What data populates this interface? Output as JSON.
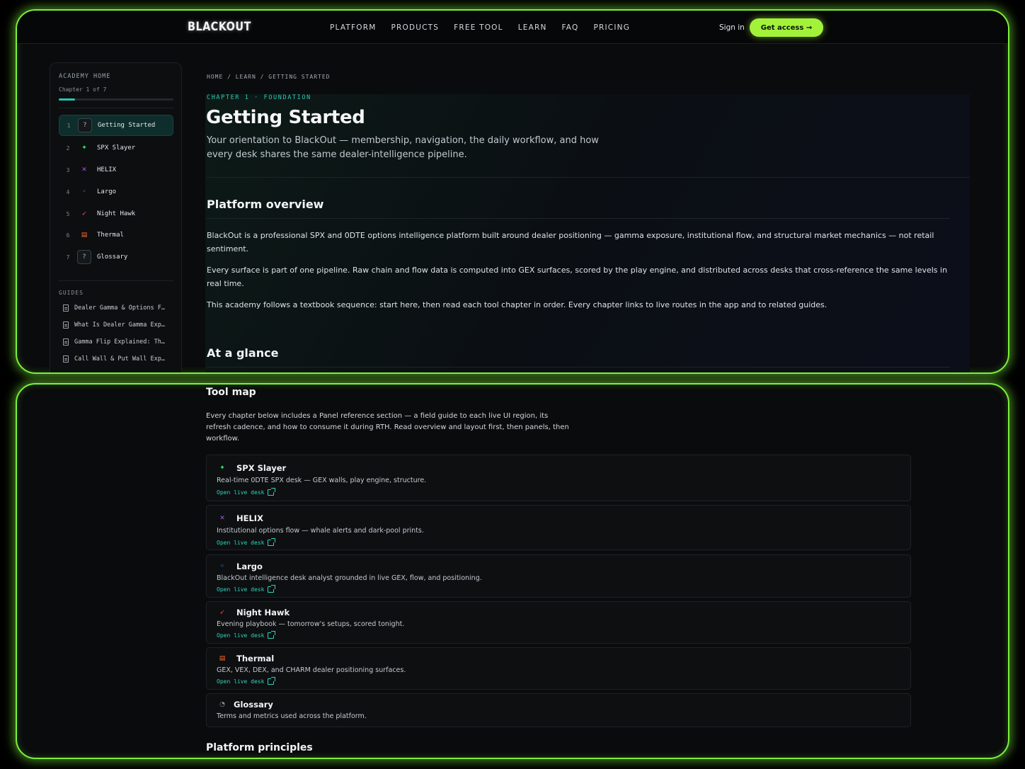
{
  "header": {
    "logo": "BLACKOUT",
    "nav": [
      "PLATFORM",
      "PRODUCTS",
      "FREE TOOL",
      "LEARN",
      "FAQ",
      "PRICING"
    ],
    "sign_in": "Sign in",
    "cta": "Get access →"
  },
  "sidebar": {
    "heading": "ACADEMY HOME",
    "progress_label": "Chapter 1 of 7",
    "progress_fraction": 0.14,
    "chapters": [
      {
        "num": "1",
        "label": "Getting Started",
        "icon": "question-icon",
        "glyph": "?",
        "active": true
      },
      {
        "num": "2",
        "label": "SPX Slayer",
        "icon": "spx-slayer-icon",
        "glyph": "✦"
      },
      {
        "num": "3",
        "label": "HELIX",
        "icon": "helix-icon",
        "glyph": "✕"
      },
      {
        "num": "4",
        "label": "Largo",
        "icon": "largo-icon",
        "glyph": "◦"
      },
      {
        "num": "5",
        "label": "Night Hawk",
        "icon": "night-hawk-icon",
        "glyph": "➶"
      },
      {
        "num": "6",
        "label": "Thermal",
        "icon": "thermal-icon",
        "glyph": "▤"
      },
      {
        "num": "7",
        "label": "Glossary",
        "icon": "question-icon",
        "glyph": "?"
      }
    ],
    "guides_heading": "GUIDES",
    "guides": [
      "Dealer Gamma & Options F…",
      "What Is Dealer Gamma Exp…",
      "Gamma Flip Explained: Th…",
      "Call Wall & Put Wall Exp…"
    ]
  },
  "main": {
    "breadcrumb": "HOME / LEARN / GETTING STARTED",
    "eyebrow": "CHAPTER 1 · FOUNDATION",
    "title": "Getting Started",
    "lede": "Your orientation to BlackOut — membership, navigation, the daily workflow, and how every desk shares the same dealer-intelligence pipeline.",
    "overview_heading": "Platform overview",
    "paragraphs": [
      "BlackOut is a professional SPX and 0DTE options intelligence platform built around dealer positioning — gamma exposure, institutional flow, and structural market mechanics — not retail sentiment.",
      "Every surface is part of one pipeline. Raw chain and flow data is computed into GEX surfaces, scored by the play engine, and distributed across desks that cross-reference the same levels in real time.",
      "This academy follows a textbook sequence: start here, then read each tool chapter in order. Every chapter links to live routes in the app and to related guides."
    ],
    "glance_heading": "At a glance"
  },
  "toolmap": {
    "heading": "Tool map",
    "intro": "Every chapter below includes a Panel reference section — a field guide to each live UI region, its refresh cadence, and how to consume it during RTH. Read overview and layout first, then panels, then workflow.",
    "link_label": "Open live desk",
    "cards": [
      {
        "title": "SPX Slayer",
        "desc": "Real-time 0DTE SPX desk — GEX walls, play engine, structure.",
        "icon": "spx-slayer-icon",
        "glyph": "✦",
        "color": "#2ee86b"
      },
      {
        "title": "HELIX",
        "desc": "Institutional options flow — whale alerts and dark-pool prints.",
        "icon": "helix-icon",
        "glyph": "✕",
        "color": "#b04cff"
      },
      {
        "title": "Largo",
        "desc": "BlackOut intelligence desk analyst grounded in live GEX, flow, and positioning.",
        "icon": "largo-icon",
        "glyph": "◦",
        "color": "#3aa0ff"
      },
      {
        "title": "Night Hawk",
        "desc": "Evening playbook — tomorrow's setups, scored tonight.",
        "icon": "night-hawk-icon",
        "glyph": "➶",
        "color": "#ff3b3b"
      },
      {
        "title": "Thermal",
        "desc": "GEX, VEX, DEX, and CHARM dealer positioning surfaces.",
        "icon": "thermal-icon",
        "glyph": "▤",
        "color": "#ff6a2a"
      },
      {
        "title": "Glossary",
        "desc": "Terms and metrics used across the platform.",
        "icon": "glossary-icon",
        "glyph": "◔",
        "color": "#8b949c"
      }
    ],
    "next_heading": "Platform principles"
  },
  "colors": {
    "accent": "#a3f23a",
    "teal": "#2bc7b0",
    "frame_glow": "#7cf03a"
  }
}
